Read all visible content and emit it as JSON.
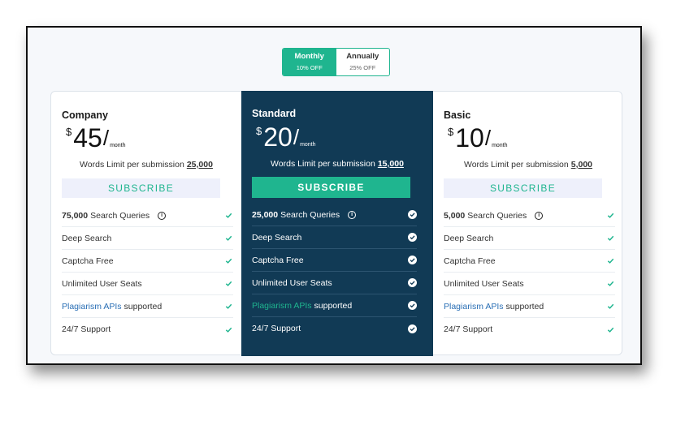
{
  "toggle": {
    "monthly": {
      "label": "Monthly",
      "discount": "10% OFF"
    },
    "annually": {
      "label": "Annually",
      "discount": "25% OFF"
    }
  },
  "colors": {
    "accent": "#1fb58f",
    "featured_bg": "#113a55",
    "link": "#2a6fb5"
  },
  "plans": [
    {
      "name": "Company",
      "currency": "$",
      "price": "45",
      "slash": "/",
      "period": "month",
      "words_label": "Words Limit per submission",
      "words_limit": "25,000",
      "subscribe": "SUBSCRIBE",
      "features": {
        "queries_num": "75,000",
        "queries_label": "Search Queries",
        "deep": "Deep Search",
        "captcha": "Captcha Free",
        "seats": "Unlimited User Seats",
        "api_link": "Plagiarism APIs",
        "api_rest": "supported",
        "support": "24/7 Support"
      }
    },
    {
      "name": "Standard",
      "currency": "$",
      "price": "20",
      "slash": "/",
      "period": "month",
      "words_label": "Words Limit per submission",
      "words_limit": "15,000",
      "subscribe": "SUBSCRIBE",
      "features": {
        "queries_num": "25,000",
        "queries_label": "Search Queries",
        "deep": "Deep Search",
        "captcha": "Captcha Free",
        "seats": "Unlimited User Seats",
        "api_link": "Plagiarism APIs",
        "api_rest": "supported",
        "support": "24/7 Support"
      }
    },
    {
      "name": "Basic",
      "currency": "$",
      "price": "10",
      "slash": "/",
      "period": "month",
      "words_label": "Words Limit per submission",
      "words_limit": "5,000",
      "subscribe": "SUBSCRIBE",
      "features": {
        "queries_num": "5,000",
        "queries_label": "Search Queries",
        "deep": "Deep Search",
        "captcha": "Captcha Free",
        "seats": "Unlimited User Seats",
        "api_link": "Plagiarism APIs",
        "api_rest": "supported",
        "support": "24/7 Support"
      }
    }
  ],
  "info_glyph": "i"
}
